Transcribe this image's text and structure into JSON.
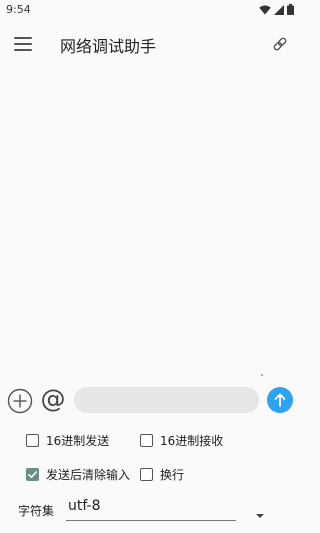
{
  "status_bar": {
    "time": "9:54",
    "icons": [
      "wifi-icon",
      "signal-icon",
      "battery-icon"
    ]
  },
  "app_bar": {
    "title": "网络调试助手",
    "left_icon": "menu-icon",
    "right_icon": "link-icon"
  },
  "input_bar": {
    "add_icon": "plus-circle-icon",
    "at_symbol": "@",
    "message_value": "",
    "send_icon": "arrow-up-icon"
  },
  "options": {
    "hex_send": {
      "label": "16进制发送",
      "checked": false
    },
    "hex_receive": {
      "label": "16进制接收",
      "checked": false
    },
    "clear_after_send": {
      "label": "发送后清除输入",
      "checked": true
    },
    "newline": {
      "label": "换行",
      "checked": false
    }
  },
  "charset": {
    "label": "字符集",
    "value": "utf-8"
  },
  "colors": {
    "accent": "#2ea3f2",
    "checkbox_checked": "#6a8f86",
    "input_bg": "#e6e6e6"
  }
}
